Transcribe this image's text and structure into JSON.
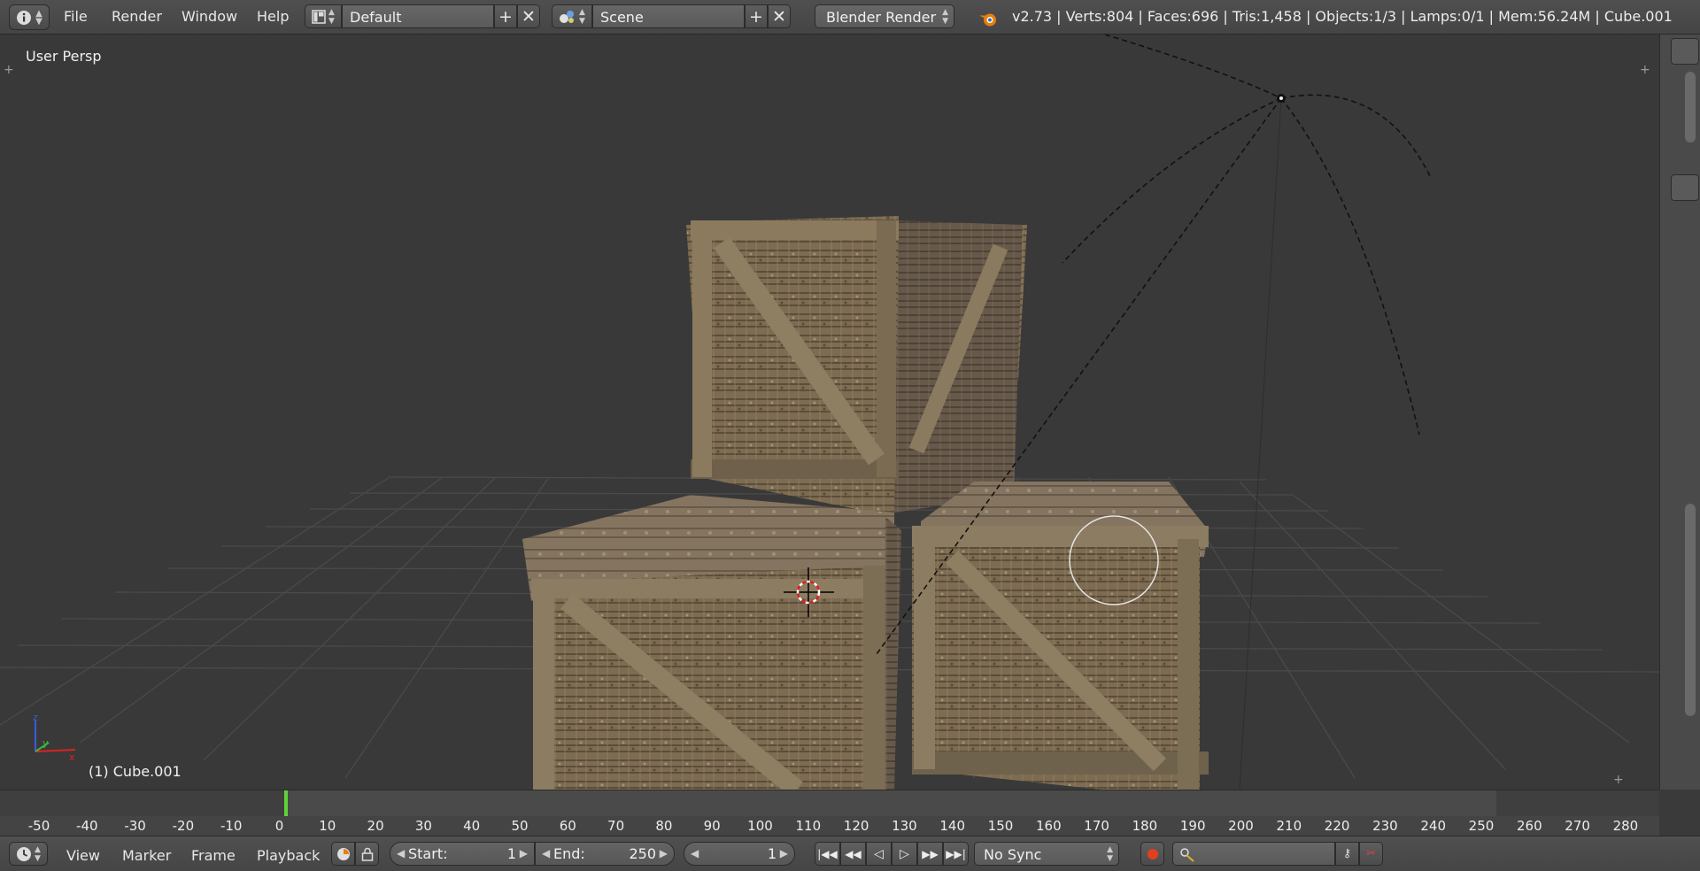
{
  "header": {
    "menu": [
      "File",
      "Render",
      "Window",
      "Help"
    ],
    "screen_layout": "Default",
    "scene": "Scene",
    "render_engine": "Blender Render",
    "stats": "v2.73 | Verts:804 | Faces:696 | Tris:1,458 | Objects:1/3 | Lamps:0/1 | Mem:56.24M | Cube.001"
  },
  "viewport": {
    "view_name": "User Persp",
    "active_object": "(1) Cube.001",
    "axes": {
      "x": "x",
      "y": "y",
      "z": "z"
    }
  },
  "timeline": {
    "ruler_labels": [
      "-50",
      "-40",
      "-30",
      "-20",
      "-10",
      "0",
      "10",
      "20",
      "30",
      "40",
      "50",
      "60",
      "70",
      "80",
      "90",
      "100",
      "110",
      "120",
      "130",
      "140",
      "150",
      "160",
      "170",
      "180",
      "190",
      "200",
      "210",
      "220",
      "230",
      "240",
      "250",
      "260",
      "270",
      "280"
    ],
    "current_frame_marker": 1,
    "menu": [
      "View",
      "Marker",
      "Frame",
      "Playback"
    ],
    "start_label": "Start:",
    "start_value": "1",
    "end_label": "End:",
    "end_value": "250",
    "current_frame": "1",
    "sync": "No Sync"
  },
  "colors": {
    "background": "#393939",
    "header": "#4a4a4a",
    "frame_marker": "#5fd33a",
    "record_button": "#e04020"
  }
}
